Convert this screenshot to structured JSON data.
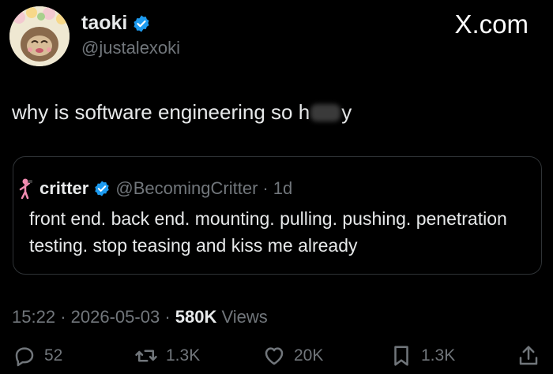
{
  "author": {
    "name": "taoki",
    "handle": "@justalexoki"
  },
  "brand": "X.com",
  "tweet": {
    "text_before": "why is software engineering so h",
    "text_after": "y"
  },
  "quote": {
    "name": "critter",
    "handle": "@BecomingCritter",
    "separator": "·",
    "age": "1d",
    "text": "front end. back end. mounting. pulling. pushing. penetration testing. stop teasing and kiss me already"
  },
  "meta": {
    "time": "15:22",
    "sep1": "·",
    "date": "2026-05-03",
    "sep2": "·",
    "views_count": "580K",
    "views_label": "Views"
  },
  "actions": {
    "replies": "52",
    "reposts": "1.3K",
    "likes": "20K",
    "bookmarks": "1.3K"
  },
  "colors": {
    "background": "#000000",
    "text": "#e7e9ea",
    "muted": "#71767b",
    "verified": "#1d9bf0",
    "border": "#2f3336"
  },
  "icons": {
    "verified": "verified-badge-icon",
    "reply": "reply-icon",
    "repost": "repost-icon",
    "like": "heart-icon",
    "bookmark": "bookmark-icon",
    "share": "share-icon"
  }
}
